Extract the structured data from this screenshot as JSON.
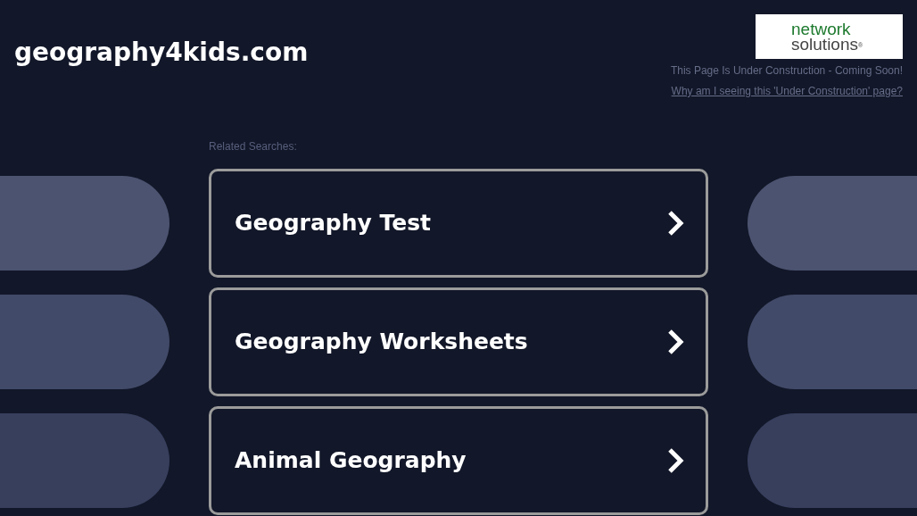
{
  "site_title": "geography4kids.com",
  "logo": {
    "line_1": "network",
    "line_2": "solutions",
    "mark": "®"
  },
  "notice": "This Page Is Under Construction - Coming Soon!",
  "notice_link": "Why am I seeing this 'Under Construction' page?",
  "related_label": "Related Searches:",
  "searches": [
    {
      "label": "Geography Test"
    },
    {
      "label": "Geography Worksheets"
    },
    {
      "label": "Animal Geography"
    }
  ]
}
